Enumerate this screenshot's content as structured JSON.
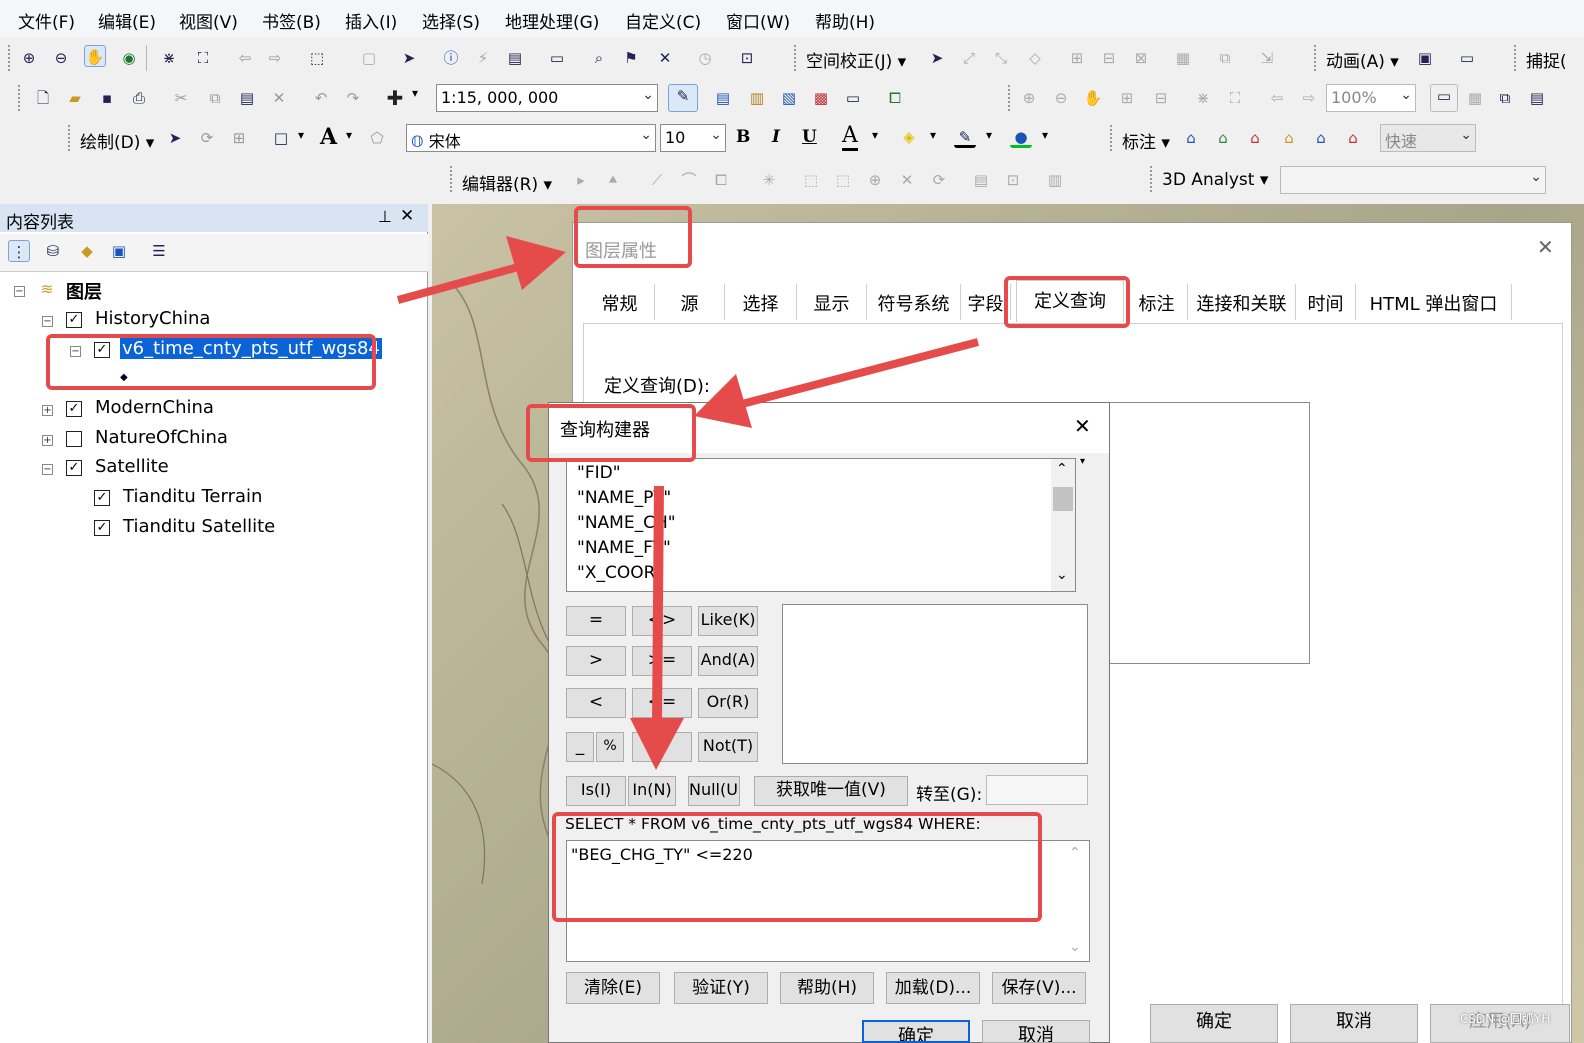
{
  "menubar": {
    "items": [
      "文件(F)",
      "编辑(E)",
      "视图(V)",
      "书签(B)",
      "插入(I)",
      "选择(S)",
      "地理处理(G)",
      "自定义(C)",
      "窗口(W)",
      "帮助(H)"
    ]
  },
  "toolbar": {
    "spatial_adjust": "空间校正(J)",
    "animation": "动画(A)",
    "snapping": "捕捉(",
    "scale_value": "1:15, 000, 000",
    "zoom_value": "100%",
    "draw": "绘制(D)",
    "font_value": "宋体",
    "font_size": "10",
    "bold": "B",
    "italic": "I",
    "underline": "U",
    "font_color_glyph": "A",
    "text_glyph": "A",
    "label": "标注",
    "quick": "快速",
    "editor": "编辑器(R)",
    "analyst": "3D Analyst"
  },
  "toc": {
    "title": "内容列表",
    "pin": "ꟷ",
    "close": "✕",
    "root": "图层",
    "layers": [
      {
        "name": "HistoryChina",
        "checked": true,
        "expand": "−"
      },
      {
        "name": "v6_time_cnty_pts_utf_wgs84",
        "checked": true,
        "expand": "−",
        "selected": true
      },
      {
        "name": "ModernChina",
        "checked": true,
        "expand": "+"
      },
      {
        "name": "NatureOfChina",
        "checked": false,
        "expand": "+"
      },
      {
        "name": "Satellite",
        "checked": true,
        "expand": "−"
      },
      {
        "name": "Tianditu Terrain",
        "checked": true
      },
      {
        "name": "Tianditu Satellite",
        "checked": true
      }
    ]
  },
  "layer_props": {
    "title": "图层属性",
    "close": "✕",
    "tabs": [
      "常规",
      "源",
      "选择",
      "显示",
      "符号系统",
      "字段",
      "定义查询",
      "标注",
      "连接和关联",
      "时间",
      "HTML 弹出窗口"
    ],
    "active_tab": "定义查询",
    "definition_label": "定义查询(D):",
    "ok": "确定",
    "cancel": "取消",
    "apply": "应用(A)"
  },
  "query_builder": {
    "title": "查询构建器",
    "close": "✕",
    "fields": [
      "\"FID\"",
      "\"NAME_PY\"",
      "\"NAME_CH\"",
      "\"NAME_FT\"",
      "\"X_COOR"
    ],
    "operators": [
      [
        "=",
        "<>",
        "Like(K)"
      ],
      [
        ">",
        ">=",
        "And(A)"
      ],
      [
        "<",
        "<=",
        "Or(R)"
      ],
      [
        "_",
        "%",
        "()",
        "Not(T)"
      ]
    ],
    "is_btn": "Is(I)",
    "in_btn": "In(N)",
    "null_btn": "Null(U)",
    "unique_btn": "获取唯一值(V)",
    "goto_label": "转至(G):",
    "select_prefix": "SELECT * FROM v6_time_cnty_pts_utf_wgs84 WHERE:",
    "expression": "\"BEG_CHG_TY\" <=220",
    "bottom_buttons": [
      "清除(E)",
      "验证(Y)",
      "帮助(H)",
      "加载(D)...",
      "保存(V)..."
    ],
    "ok": "确定",
    "cancel": "取消"
  },
  "watermark": "CSDN @圆弧YH",
  "colors": {
    "highlight": "#e64b4b",
    "selection": "#0a64d8"
  }
}
